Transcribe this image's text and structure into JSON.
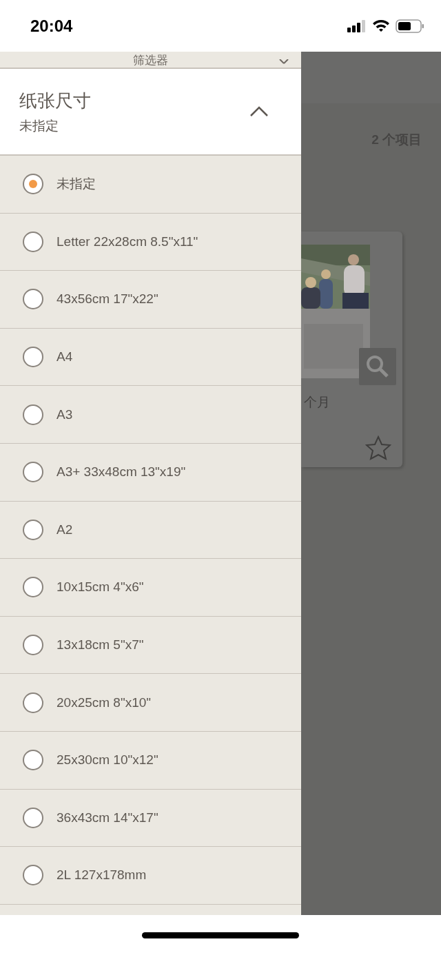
{
  "status_bar": {
    "time": "20:04"
  },
  "drawer": {
    "title": "筛选器",
    "section": {
      "label": "纸张尺寸",
      "value": "未指定",
      "expanded": true
    },
    "options": [
      {
        "label": "未指定",
        "selected": true
      },
      {
        "label": "Letter 22x28cm 8.5\"x11\"",
        "selected": false
      },
      {
        "label": "43x56cm 17\"x22\"",
        "selected": false
      },
      {
        "label": "A4",
        "selected": false
      },
      {
        "label": "A3",
        "selected": false
      },
      {
        "label": "A3+ 33x48cm 13\"x19\"",
        "selected": false
      },
      {
        "label": "A2",
        "selected": false
      },
      {
        "label": "10x15cm 4\"x6\"",
        "selected": false
      },
      {
        "label": "13x18cm 5\"x7\"",
        "selected": false
      },
      {
        "label": "20x25cm 8\"x10\"",
        "selected": false
      },
      {
        "label": "25x30cm 10\"x12\"",
        "selected": false
      },
      {
        "label": "36x43cm 14\"x17\"",
        "selected": false
      },
      {
        "label": "2L 127x178mm",
        "selected": false
      }
    ]
  },
  "background": {
    "count": "2 个项目",
    "card": {
      "title": "个月"
    }
  }
}
